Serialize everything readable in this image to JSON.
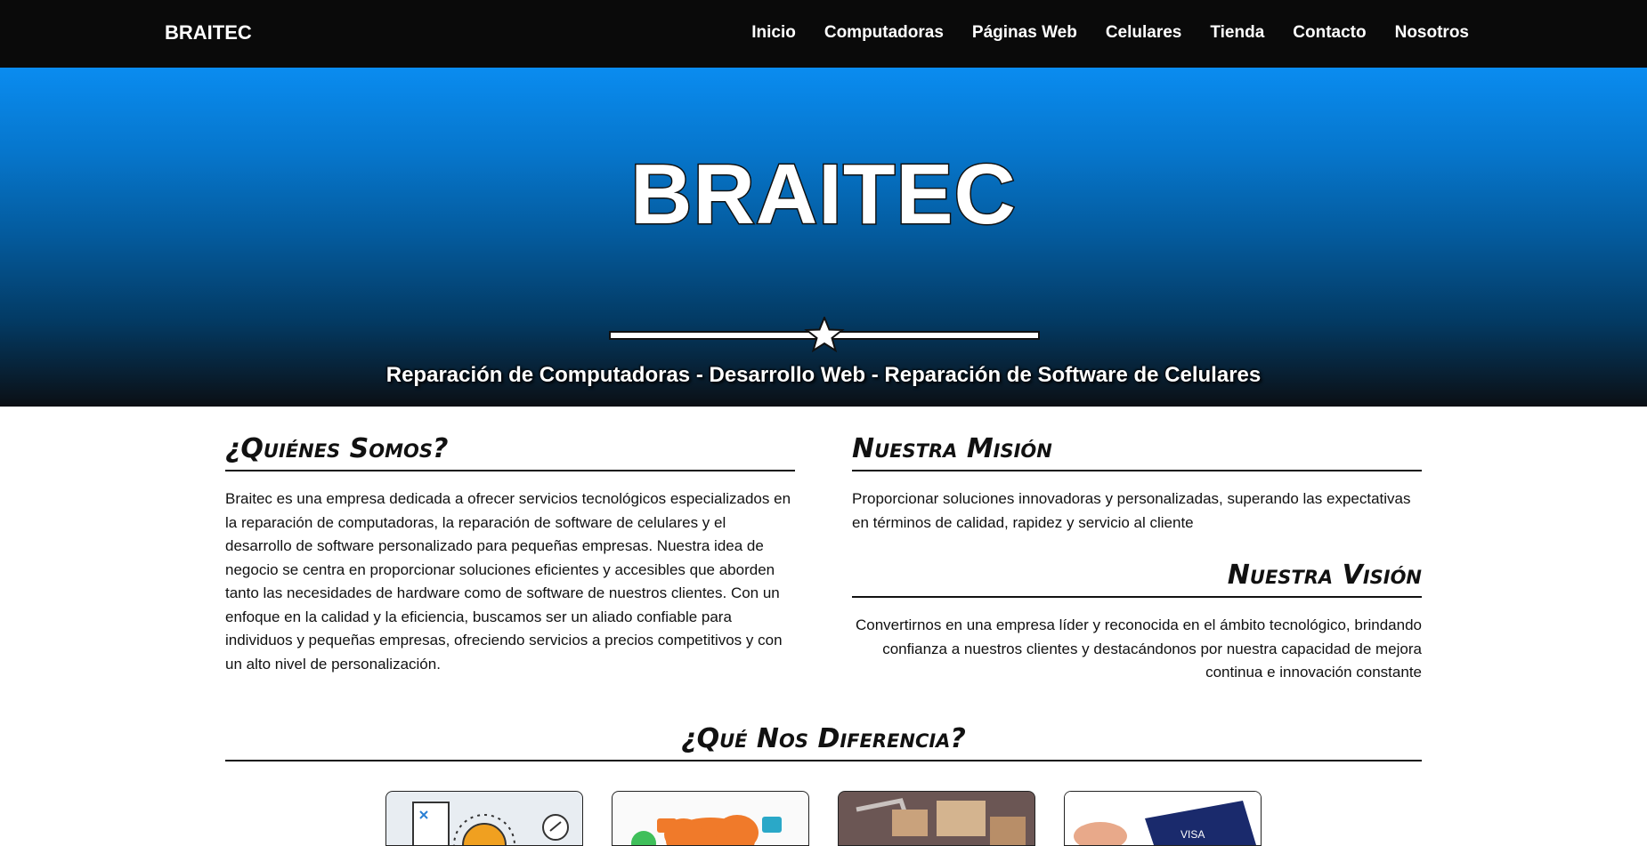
{
  "navbar": {
    "brand": "BRAITEC",
    "links": [
      "Inicio",
      "Computadoras",
      "Páginas Web",
      "Celulares",
      "Tienda",
      "Contacto",
      "Nosotros"
    ]
  },
  "hero": {
    "title": "BRAITEC",
    "divider_icon": "star-icon",
    "subtitle": "Reparación de Computadoras - Desarrollo Web - Reparación de Software de Celulares"
  },
  "about": {
    "title": "¿Quiénes Somos?",
    "text": "Braitec es una empresa dedicada a ofrecer servicios tecnológicos especializados en la reparación de computadoras, la reparación de software de celulares y el desarrollo de software personalizado para pequeñas empresas. Nuestra idea de negocio se centra en proporcionar soluciones eficientes y accesibles que aborden tanto las necesidades de hardware como de software de nuestros clientes. Con un enfoque en la calidad y la eficiencia, buscamos ser un aliado confiable para individuos y pequeñas empresas, ofreciendo servicios a precios competitivos y con un alto nivel de personalización."
  },
  "mission": {
    "title": "Nuestra Misión",
    "text": "Proporcionar soluciones innovadoras y personalizadas, superando las expectativas en términos de calidad, rapidez y servicio al cliente"
  },
  "vision": {
    "title": "Nuestra Visión",
    "text": "Convertirnos en una empresa líder y reconocida en el ámbito tecnológico, brindando confianza a nuestros clientes y destacándonos por nuestra capacidad de mejora continua e innovación constante"
  },
  "differences": {
    "title": "¿Qué Nos Diferencia?",
    "cards": [
      {
        "icon": "planning-illustration-icon"
      },
      {
        "icon": "discount-cloud-illustration-icon"
      },
      {
        "icon": "package-boxes-photo-icon"
      },
      {
        "icon": "credit-card-payment-photo-icon"
      }
    ]
  },
  "colors": {
    "nav_bg": "#0a0a0a",
    "hero_top": "#0a8cf0",
    "hero_bottom": "#0b0f14"
  }
}
